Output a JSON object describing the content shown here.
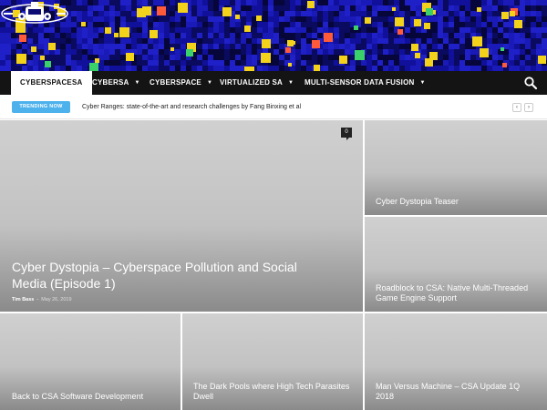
{
  "nav": {
    "items": [
      {
        "label": "CYBERSPACESA",
        "active": true,
        "has_dropdown": false
      },
      {
        "label": "CYBERSA",
        "active": false,
        "has_dropdown": true
      },
      {
        "label": "CYBERSPACE",
        "active": false,
        "has_dropdown": true
      },
      {
        "label": "VIRTUALIZED SA",
        "active": false,
        "has_dropdown": true
      },
      {
        "label": "MULTI-SENSOR DATA FUSION",
        "active": false,
        "has_dropdown": true
      }
    ],
    "search_icon": "search-icon"
  },
  "trending": {
    "badge": "TRENDING NOW",
    "headline": "Cyber Ranges: state-of-the-art and research challenges by Fang Binxing et al",
    "prev": "‹",
    "next": "›"
  },
  "posts": {
    "main": {
      "title": "Cyber Dystopia – Cyberspace Pollution and Social Media (Episode 1)",
      "author": "Tim Bass",
      "separator": "-",
      "date": "May 26, 2019",
      "comments": "0"
    },
    "side_top": {
      "title": "Cyber Dystopia Teaser"
    },
    "side_bottom": {
      "title": "Roadblock to CSA: Native Multi-Threaded Game Engine Support"
    },
    "bottom": [
      {
        "title": "Back to CSA Software Development"
      },
      {
        "title": "The Dark Pools where High Tech Parasites Dwell"
      },
      {
        "title": "Man Versus Machine – CSA Update 1Q 2018"
      }
    ]
  },
  "colors": {
    "header_bg": "#0c0c74",
    "nav_bg": "#141414",
    "trending_badge": "#4db2ec",
    "thumb_gray": "#c4c4c4"
  }
}
